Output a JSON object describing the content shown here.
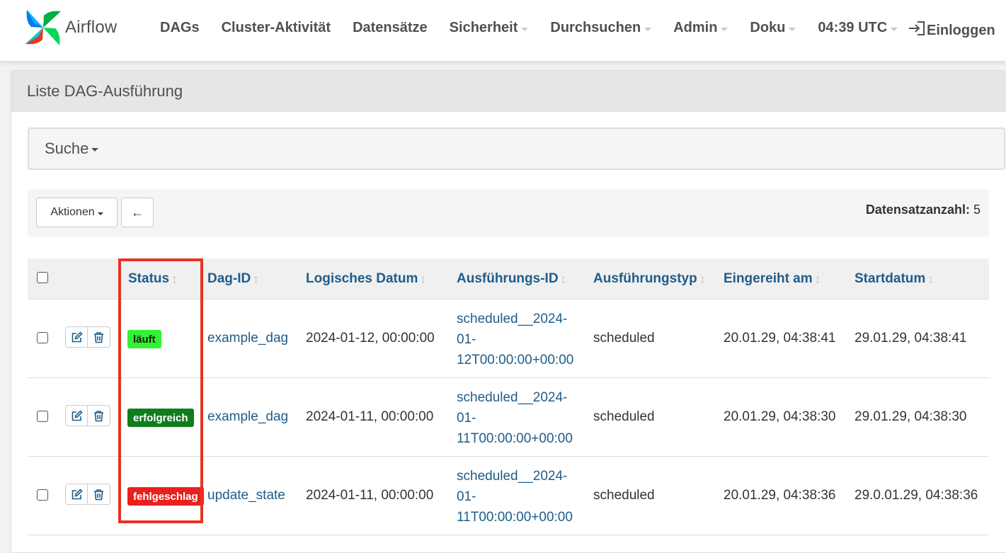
{
  "navbar": {
    "brand": "Airflow",
    "items": [
      {
        "label": "DAGs",
        "dropdown": false
      },
      {
        "label": "Cluster-Aktivität",
        "dropdown": false
      },
      {
        "label": "Datensätze",
        "dropdown": false
      },
      {
        "label": "Sicherheit",
        "dropdown": true
      },
      {
        "label": "Durchsuchen",
        "dropdown": true
      },
      {
        "label": "Admin",
        "dropdown": true
      },
      {
        "label": "Doku",
        "dropdown": true
      },
      {
        "label": "04:39 UTC",
        "dropdown": true
      }
    ],
    "login": "Einloggen",
    "icons": {
      "logo": "airflow-pinwheel-icon",
      "login": "sign-in-icon"
    }
  },
  "panel": {
    "title": "Liste DAG-Ausführung"
  },
  "search": {
    "label": "Suche"
  },
  "toolbar": {
    "actions_label": "Aktionen",
    "back_icon": "←",
    "record_count_label": "Datensatzanzahl:",
    "record_count": "5"
  },
  "table": {
    "columns": {
      "status": "Status",
      "dag_id": "Dag-ID",
      "logical_date": "Logisches Datum",
      "run_id": "Ausführungs-ID",
      "run_type": "Ausführungstyp",
      "queued_at": "Eingereiht am",
      "start_date": "Startdatum"
    },
    "sort_icon": "↕",
    "rows": [
      {
        "status": "läuft",
        "status_color": "#33f233",
        "status_text_color": "#1a1a1a",
        "dag_id": "example_dag",
        "logical_date": "2024-01-12, 00:00:00",
        "run_id_lines": [
          "scheduled__2024-",
          "01-",
          "12T00:00:00+00:00"
        ],
        "run_type": "scheduled",
        "queued_at": "20.01.29, 04:38:41",
        "start_date": "29.01.29, 04:38:41"
      },
      {
        "status": "erfolgreich",
        "status_color": "#0f7d1e",
        "status_text_color": "#ffffff",
        "dag_id": "example_dag",
        "logical_date": "2024-01-11, 00:00:00",
        "run_id_lines": [
          "scheduled__2024-",
          "01-",
          "11T00:00:00+00:00"
        ],
        "run_type": "scheduled",
        "queued_at": "20.01.29, 04:38:30",
        "start_date": "29.01.29, 04:38:30"
      },
      {
        "status": "fehlgeschlag",
        "status_color": "#e8201e",
        "status_text_color": "#ffffff",
        "dag_id": "update_state",
        "logical_date": "2024-01-11, 00:00:00",
        "run_id_lines": [
          "scheduled__2024-",
          "01-",
          "11T00:00:00+00:00"
        ],
        "run_type": "scheduled",
        "queued_at": "20.01.29, 04:38:36",
        "start_date": "29.0.01.29, 04:38:36"
      }
    ]
  },
  "annotation": {
    "highlight_color": "#e63323",
    "target": "status-column"
  }
}
